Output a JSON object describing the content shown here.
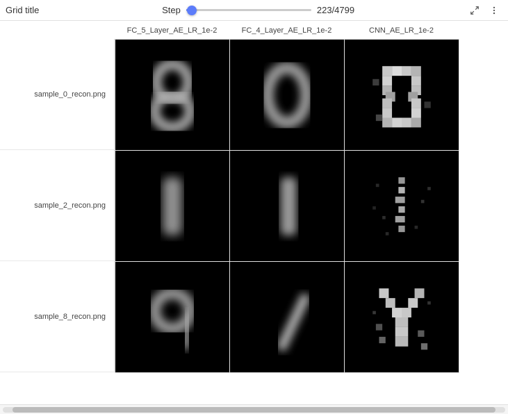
{
  "header": {
    "title": "Grid title",
    "step_label": "Step",
    "step_value": "223/4799",
    "slider_percent": 4.6,
    "fullscreen_icon": "⛶",
    "more_icon": "⋮"
  },
  "columns": [
    {
      "label": "FC_5_Layer_AE_LR_1e-2"
    },
    {
      "label": "FC_4_Layer_AE_LR_1e-2"
    },
    {
      "label": "CNN_AE_LR_1e-2"
    }
  ],
  "rows": [
    {
      "label": "sample_0_recon.png"
    },
    {
      "label": "sample_2_recon.png"
    },
    {
      "label": "sample_8_recon.png"
    }
  ],
  "colors": {
    "accent": "#5c7cfa",
    "border": "#e0e0e0",
    "bg": "#ffffff",
    "cell_bg": "#000000"
  }
}
